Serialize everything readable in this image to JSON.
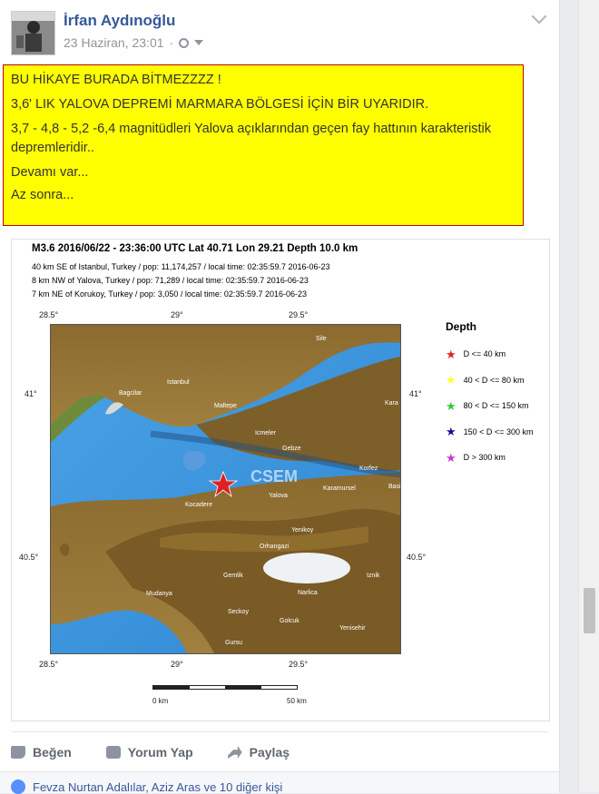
{
  "post": {
    "author": "İrfan Aydınoğlu",
    "timestamp": "23 Haziran, 23:01",
    "privacy_icon": "globe-icon",
    "text_lines": [
      "BU HİKAYE BURADA BİTMEZZZZ !",
      "3,6' LIK YALOVA DEPREMİ MARMARA BÖLGESİ İÇİN BİR UYARIDIR.",
      "3,7 - 4,8 - 5,2 -6,4 magnitüdleri Yalova açıklarından geçen fay hattının karakteristik depremleridir..",
      "Devamı var...",
      "Az sonra..."
    ]
  },
  "quake_map": {
    "header": "M3.6  2016/06/22 - 23:36:00 UTC    Lat 40.71   Lon  29.21      Depth  10.0 km",
    "line1": "40 km SE of Istanbul, Turkey / pop: 11,174,257 / local time: 02:35:59.7 2016-06-23",
    "line2": "8 km NW of Yalova, Turkey / pop: 71,289 / local time: 02:35:59.7 2016-06-23",
    "line3": "7 km NE of Korukoy, Turkey / pop: 3,050 / local time: 02:35:59.7 2016-06-23",
    "lon_left": "28.5°",
    "lon_mid": "29°",
    "lon_right": "29.5°",
    "lat_top": "41°",
    "lat_bottom": "40.5°",
    "watermark": "CSEM",
    "places": [
      "Sile",
      "Bagcilar",
      "Istanbul",
      "Maltepe",
      "Icmeler",
      "Gebze",
      "Kara",
      "Korfez",
      "Karamursel",
      "Basi",
      "Yalova",
      "Kocadere",
      "Yenikoy",
      "Orhangazi",
      "Gemlik",
      "Mudanya",
      "Iznik",
      "Narlica",
      "Seckoy",
      "Golcuk",
      "Yenisehir",
      "Gursu"
    ],
    "legend_title": "Depth",
    "legend": [
      {
        "label": "D <= 40 km",
        "color": "#e02020"
      },
      {
        "label": "40 < D <= 80 km",
        "color": "#ffff33"
      },
      {
        "label": "80 < D <= 150 km",
        "color": "#33cc33"
      },
      {
        "label": "150 < D <= 300 km",
        "color": "#101090"
      },
      {
        "label": "D > 300 km",
        "color": "#cc33cc"
      }
    ],
    "scale_start": "0 km",
    "scale_end": "50 km"
  },
  "actions": {
    "like": "Beğen",
    "comment": "Yorum Yap",
    "share": "Paylaş"
  },
  "likes_text_names": "Fevza Nurtan Adalılar, Aziz Aras ve 10 diğer kişi"
}
